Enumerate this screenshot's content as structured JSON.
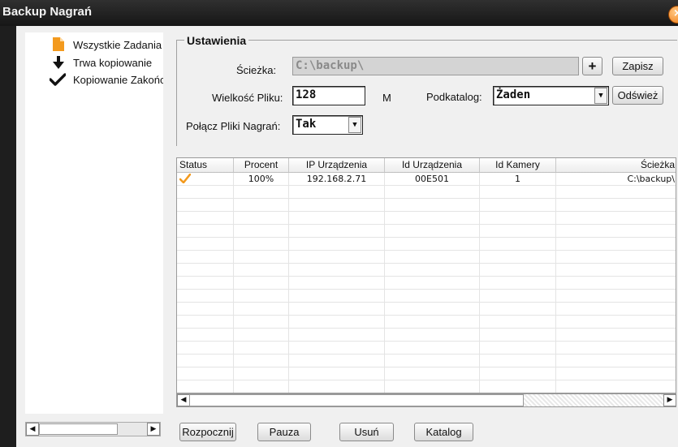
{
  "window": {
    "title": "Backup Nagrań",
    "close_icon": "close-icon"
  },
  "tree": {
    "items": [
      {
        "label": "Wszystkie Zadania",
        "icon": "document-icon"
      },
      {
        "label": "Trwa kopiowanie",
        "icon": "arrow-down-icon"
      },
      {
        "label": "Kopiowanie Zakończone",
        "icon": "checkmark-icon"
      }
    ]
  },
  "settings": {
    "group_title": "Ustawienia",
    "path_label": "Ścieżka:",
    "path_value": "C:\\backup\\",
    "add_button": "+",
    "save_button": "Zapisz",
    "filesize_label": "Wielkość Pliku:",
    "filesize_value": "128",
    "filesize_unit": "M",
    "subdir_label": "Podkatalog:",
    "subdir_value": "Żaden",
    "refresh_button": "Odśwież",
    "merge_label": "Połącz Pliki Nagrań:",
    "merge_value": "Tak"
  },
  "table": {
    "columns": [
      "Status",
      "Procent",
      "IP Urządzenia",
      "Id Urządzenia",
      "Id Kamery",
      "Ścieżka"
    ],
    "rows": [
      {
        "status_icon": "checkmark-icon",
        "percent": "100%",
        "ip": "192.168.2.71",
        "device_id": "00E501",
        "camera_id": "1",
        "path": "C:\\backup\\"
      }
    ]
  },
  "actions": {
    "start": "Rozpocznij",
    "pause": "Pauza",
    "delete": "Usuń",
    "folder": "Katalog"
  },
  "colors": {
    "title_bar": "#1e1e1e",
    "accent_orange": "#f39a1e"
  }
}
